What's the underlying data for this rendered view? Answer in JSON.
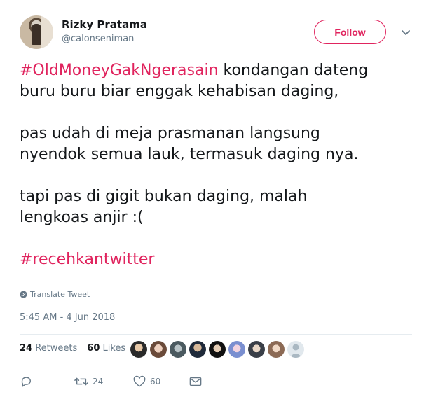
{
  "author": {
    "name": "Rizky Pratama",
    "handle": "@calonseniman",
    "follow_label": "Follow"
  },
  "tweet": {
    "hashtag1": "#OldMoneyGakNgerasain",
    "line1_rest": " kondangan dateng",
    "line2": "buru buru biar enggak kehabisan daging,",
    "line3": "pas udah di meja prasmanan langsung",
    "line4": "nyendok semua lauk, termasuk daging nya.",
    "line5": "tapi pas di gigit bukan daging, malah",
    "line6": "lengkoas anjir :(",
    "hashtag2": "#recehkantwitter"
  },
  "translate_label": "Translate Tweet",
  "timestamp": "5:45 AM - 4 Jun 2018",
  "stats": {
    "retweets_count": "24",
    "retweets_label": "Retweets",
    "likes_count": "60",
    "likes_label": "Likes"
  },
  "actions": {
    "retweet_count": "24",
    "like_count": "60"
  },
  "colors": {
    "accent": "#e0245e",
    "muted": "#657786",
    "text": "#14171a"
  },
  "icons": [
    "chevron-down-icon",
    "globe-icon",
    "reply-icon",
    "retweet-icon",
    "heart-icon",
    "message-icon"
  ]
}
